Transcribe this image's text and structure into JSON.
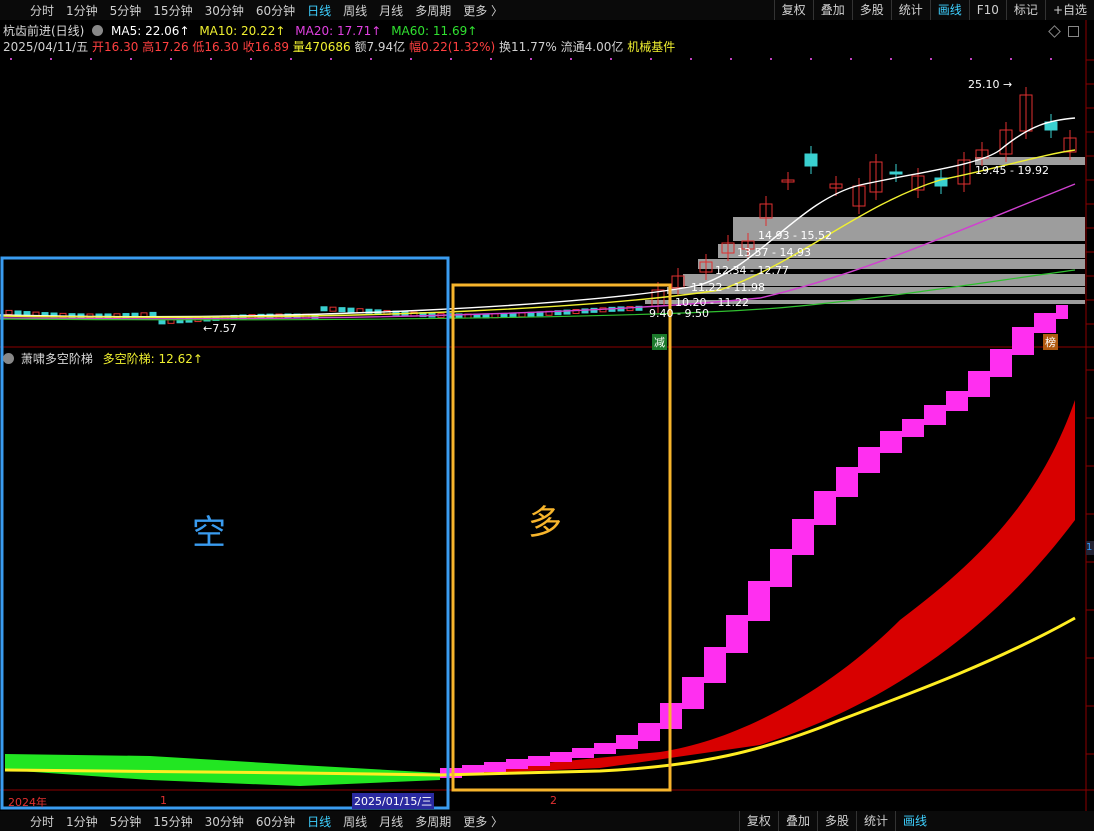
{
  "toolbar": {
    "tabs": [
      "分时",
      "1分钟",
      "5分钟",
      "15分钟",
      "30分钟",
      "60分钟",
      "日线",
      "周线",
      "月线",
      "多周期",
      "更多 〉"
    ],
    "active": "日线",
    "right_top": [
      "复权",
      "叠加",
      "多股",
      "统计",
      "画线",
      "F10",
      "标记",
      "+自选"
    ],
    "right_bottom": [
      "复权",
      "叠加",
      "多股",
      "统计",
      "画线"
    ]
  },
  "header": {
    "stock": "杭齿前进(日线)",
    "ma5": "MA5: 22.06↑",
    "ma10": "MA10: 20.22↑",
    "ma20": "MA20: 17.71↑",
    "ma60": "MA60: 11.69↑",
    "date": "2025/04/11/五",
    "open": "开16.30",
    "high": "高17.26",
    "low": "低16.30",
    "close": "收16.89",
    "volume": "量470686",
    "amount": "额7.94亿",
    "change": "幅0.22(1.32%)",
    "turnover": "换11.77%",
    "float_cap": "流通4.00亿",
    "sector": "机械基件"
  },
  "price_labels": {
    "high_mark": "25.10",
    "low_mark": "7.57",
    "zones": [
      "19.45 - 19.92",
      "14.93 - 15.52",
      "13.57 - 14.93",
      "12.34 - 12.77",
      "11.22 - 11.98",
      "10.20 - 11.22",
      "9.40 - 9.50"
    ],
    "badge_left": "减",
    "badge_right": "榜"
  },
  "indicator": {
    "name": "萧啸多空阶梯",
    "value_label": "多空阶梯: 12.62↑",
    "box_bear": "空",
    "box_bull": "多"
  },
  "time_axis": {
    "year": "2024年",
    "m1": "1",
    "date_marker": "2025/01/15/三",
    "m2": "2"
  },
  "colors": {
    "bear_box": "#3a9cf0",
    "bull_box": "#f7b52c",
    "ladder_top": "#ff2ff0",
    "ladder_fill": "#d80000",
    "signal_line": "#ffee22",
    "green_zone": "#22e622"
  }
}
